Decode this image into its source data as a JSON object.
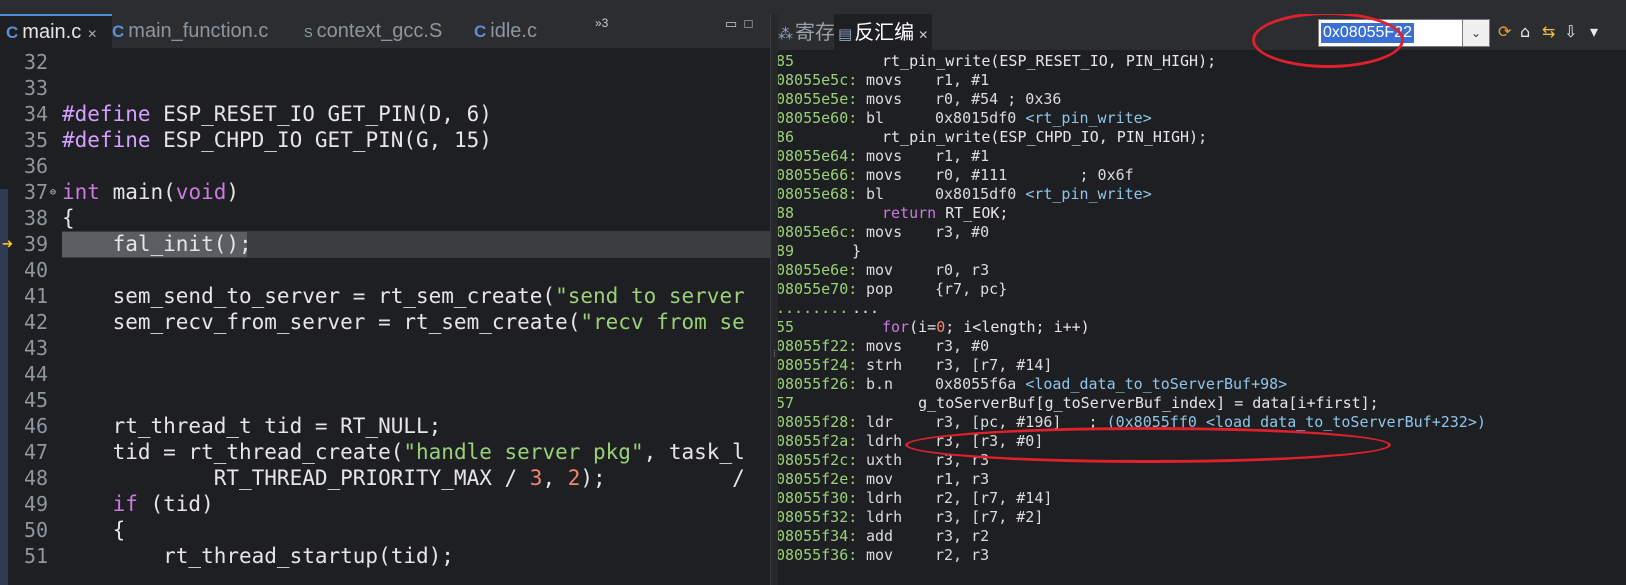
{
  "editor": {
    "tabs": [
      {
        "icon": "C",
        "label": "main.c",
        "active": true,
        "close": "✕"
      },
      {
        "icon": "C",
        "label": "main_function.c",
        "active": false
      },
      {
        "icon": "S",
        "label": "context_gcc.S",
        "active": false
      },
      {
        "icon": "C",
        "label": "idle.c",
        "active": false
      }
    ],
    "overflow_label": "»3",
    "lines": [
      {
        "num": "32",
        "text": ""
      },
      {
        "num": "33",
        "text": ""
      },
      {
        "num": "34",
        "pre": "#define",
        "text": " ESP_RESET_IO GET_PIN(D, 6)"
      },
      {
        "num": "35",
        "pre": "#define",
        "text": " ESP_CHPD_IO GET_PIN(G, 15)"
      },
      {
        "num": "36",
        "text": ""
      },
      {
        "num": "37",
        "pre": "int",
        "text": " main(",
        "post_kw": "void",
        "tail": ")"
      },
      {
        "num": "38",
        "text": "{"
      },
      {
        "num": "39",
        "text": "    fal_init();"
      },
      {
        "num": "40",
        "text": ""
      },
      {
        "num": "41",
        "text": "    sem_send_to_server = rt_sem_create(",
        "str": "\"send to server"
      },
      {
        "num": "42",
        "text": "    sem_recv_from_server = rt_sem_create(",
        "str": "\"recv from se"
      },
      {
        "num": "43",
        "text": ""
      },
      {
        "num": "44",
        "text": ""
      },
      {
        "num": "45",
        "text": ""
      },
      {
        "num": "46",
        "text": "    rt_thread_t tid = RT_NULL;"
      },
      {
        "num": "47",
        "text": "    tid = rt_thread_create(",
        "str": "\"handle server pkg\"",
        "tail": ", task_l"
      },
      {
        "num": "48",
        "text": "            RT_THREAD_PRIORITY_MAX / ",
        "n1": "3",
        "mid": ", ",
        "n2": "2",
        "tail": ");          /"
      },
      {
        "num": "49",
        "pre": "    if",
        "text": " (tid)"
      },
      {
        "num": "50",
        "text": "    {"
      },
      {
        "num": "51",
        "text": "        rt_thread_startup(tid);"
      }
    ]
  },
  "disasm": {
    "tabs": [
      {
        "label": "寄存器",
        "active": false
      },
      {
        "label": "反汇编",
        "active": true,
        "close": "✕"
      }
    ],
    "address_value": "0x08055F22",
    "dropdown_glyph": "⌄",
    "lines": [
      {
        "kind": "src",
        "num": "85",
        "code": "rt_pin_write(ESP_RESET_IO, PIN_HIGH);"
      },
      {
        "kind": "ins",
        "addr": "08055e5c:",
        "mn": "movs",
        "op": "r1, #1"
      },
      {
        "kind": "ins",
        "addr": "08055e5e:",
        "mn": "movs",
        "op": "r0, #54 ; 0x36"
      },
      {
        "kind": "ins",
        "addr": "08055e60:",
        "mn": "bl",
        "op": "0x8015df0 ",
        "sym": "<rt_pin_write>"
      },
      {
        "kind": "src",
        "num": "86",
        "code": "rt_pin_write(ESP_CHPD_IO, PIN_HIGH);"
      },
      {
        "kind": "ins",
        "addr": "08055e64:",
        "mn": "movs",
        "op": "r1, #1"
      },
      {
        "kind": "ins",
        "addr": "08055e66:",
        "mn": "movs",
        "op": "r0, #111        ; 0x6f"
      },
      {
        "kind": "ins",
        "addr": "08055e68:",
        "mn": "bl",
        "op": "0x8015df0 ",
        "sym": "<rt_pin_write>"
      },
      {
        "kind": "src",
        "num": "88",
        "kw": "return",
        "code": " RT_EOK;"
      },
      {
        "kind": "ins",
        "addr": "08055e6c:",
        "mn": "movs",
        "op": "r3, #0"
      },
      {
        "kind": "src",
        "num": "89",
        "code": "}",
        "brace": true
      },
      {
        "kind": "ins",
        "addr": "08055e6e:",
        "mn": "mov",
        "op": "r0, r3"
      },
      {
        "kind": "ins",
        "addr": "08055e70:",
        "mn": "pop",
        "op": "{r7, pc}"
      },
      {
        "kind": "dots",
        "addr": "........",
        "code": "..."
      },
      {
        "kind": "src",
        "num": "55",
        "kw": "for",
        "code": "(i=",
        "n": "0",
        "tail": "; i<length; i++)"
      },
      {
        "kind": "ins",
        "addr": "08055f22:",
        "mn": "movs",
        "op": "r3, #0"
      },
      {
        "kind": "ins",
        "addr": "08055f24:",
        "mn": "strh",
        "op": "r3, [r7, #14]"
      },
      {
        "kind": "ins",
        "addr": "08055f26:",
        "mn": "b.n",
        "op": "0x8055f6a ",
        "sym": "<load_data_to_toServerBuf+98>"
      },
      {
        "kind": "src",
        "num": "57",
        "code": "    g_toServerBuf[g_toServerBuf_index] = data[i+first];"
      },
      {
        "kind": "ins",
        "addr": "08055f28:",
        "mn": "ldr",
        "op": "r3, [pc, #196]   ; ",
        "sym": "(0x8055ff0 <load_data_to_toServerBuf+232>)"
      },
      {
        "kind": "ins",
        "addr": "08055f2a:",
        "mn": "ldrh",
        "op": "r3, [r3, #0]"
      },
      {
        "kind": "ins",
        "addr": "08055f2c:",
        "mn": "uxth",
        "op": "r3, r3"
      },
      {
        "kind": "ins",
        "addr": "08055f2e:",
        "mn": "mov",
        "op": "r1, r3"
      },
      {
        "kind": "ins",
        "addr": "08055f30:",
        "mn": "ldrh",
        "op": "r2, [r7, #14]"
      },
      {
        "kind": "ins",
        "addr": "08055f32:",
        "mn": "ldrh",
        "op": "r3, [r7, #2]"
      },
      {
        "kind": "ins",
        "addr": "08055f34:",
        "mn": "add",
        "op": "r3, r2"
      },
      {
        "kind": "ins",
        "addr": "08055f36:",
        "mn": "mov",
        "op": "r2, r3"
      }
    ]
  }
}
